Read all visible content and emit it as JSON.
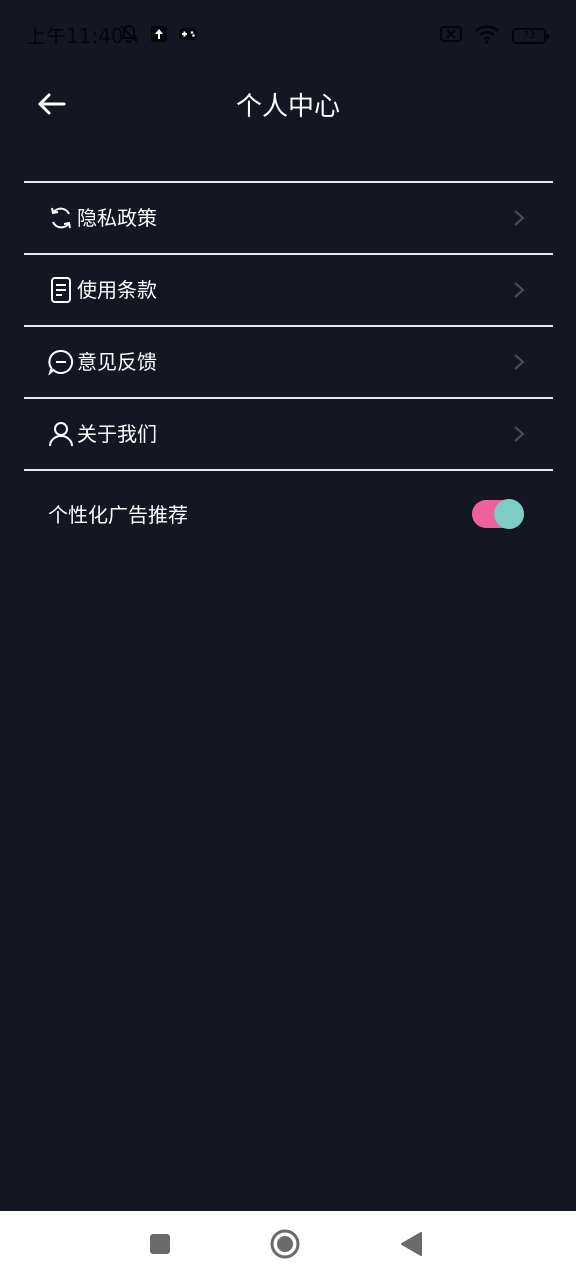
{
  "status_bar": {
    "time": "上午11:40",
    "battery": "73"
  },
  "header": {
    "title": "个人中心"
  },
  "menu": {
    "items": [
      {
        "label": "隐私政策",
        "icon": "refresh-icon"
      },
      {
        "label": "使用条款",
        "icon": "document-icon"
      },
      {
        "label": "意见反馈",
        "icon": "chat-icon"
      },
      {
        "label": "关于我们",
        "icon": "person-icon"
      }
    ]
  },
  "settings": {
    "personalized_ads_label": "个性化广告推荐",
    "personalized_ads_enabled": true
  },
  "colors": {
    "background": "#141622",
    "toggle_track": "#f0609b",
    "toggle_knob": "#7ecdc5",
    "divider": "#e8e8ec"
  }
}
